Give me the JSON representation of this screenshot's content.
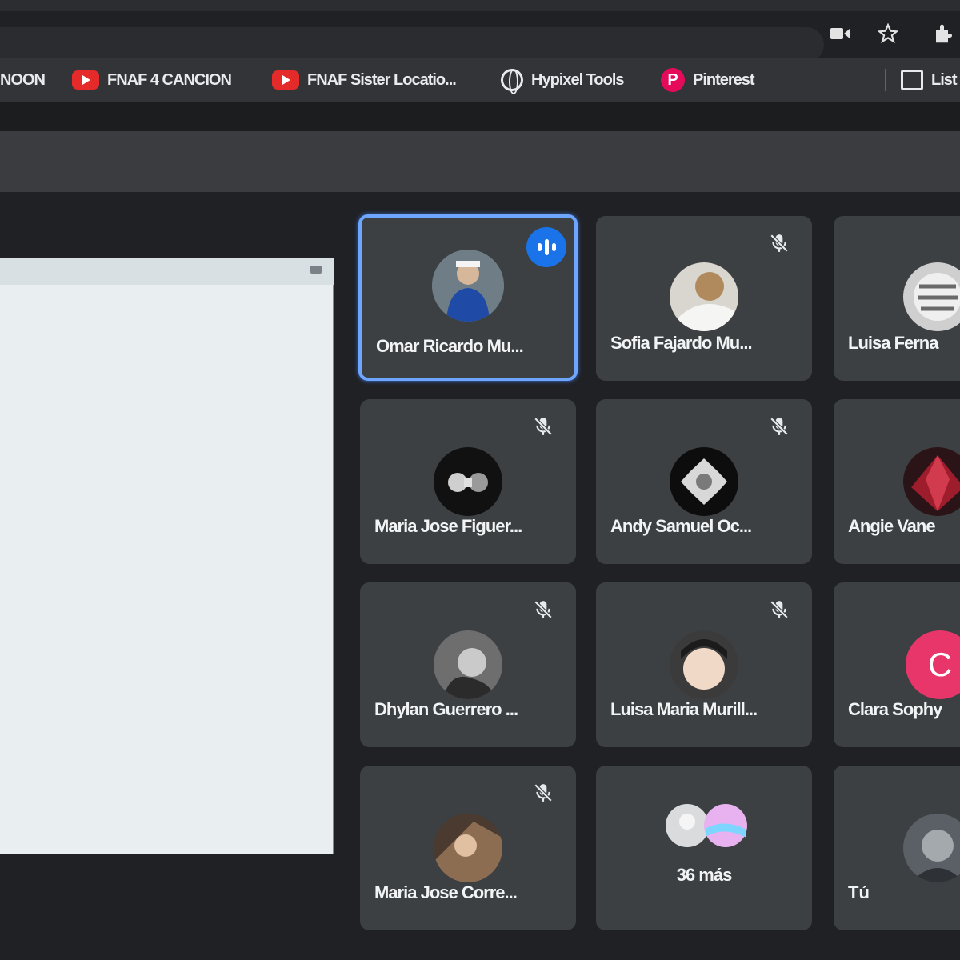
{
  "bookmarks": [
    {
      "label": "NOON",
      "icon": "none"
    },
    {
      "label": "FNAF 4 CANCION",
      "icon": "youtube-icon"
    },
    {
      "label": "FNAF Sister Locatio...",
      "icon": "youtube-icon"
    },
    {
      "label": "Hypixel Tools",
      "icon": "globe-icon"
    },
    {
      "label": "Pinterest",
      "icon": "pinterest-icon"
    },
    {
      "label": "List",
      "icon": "reading-list-icon"
    }
  ],
  "participants": [
    {
      "name": "Omar Ricardo Mu...",
      "speaking": true
    },
    {
      "name": "Sofia Fajardo Mu...",
      "muted": true
    },
    {
      "name": "Luisa Ferna",
      "muted": false
    },
    {
      "name": "Maria Jose Figuer...",
      "muted": true
    },
    {
      "name": "Andy Samuel Oc...",
      "muted": true
    },
    {
      "name": "Angie Vane",
      "muted": false
    },
    {
      "name": "Dhylan Guerrero ...",
      "muted": true
    },
    {
      "name": "Luisa Maria Murill...",
      "muted": true
    },
    {
      "name": "Clara Sophy",
      "muted": false,
      "initial": "C"
    },
    {
      "name": "Maria Jose Corre...",
      "muted": true
    }
  ],
  "more": {
    "label": "36 más"
  },
  "self": {
    "label": "Tú"
  },
  "colors": {
    "accent": "#1a73e8",
    "tile": "#3c4043",
    "background": "#202124",
    "avatar_c": "#e8366b"
  }
}
